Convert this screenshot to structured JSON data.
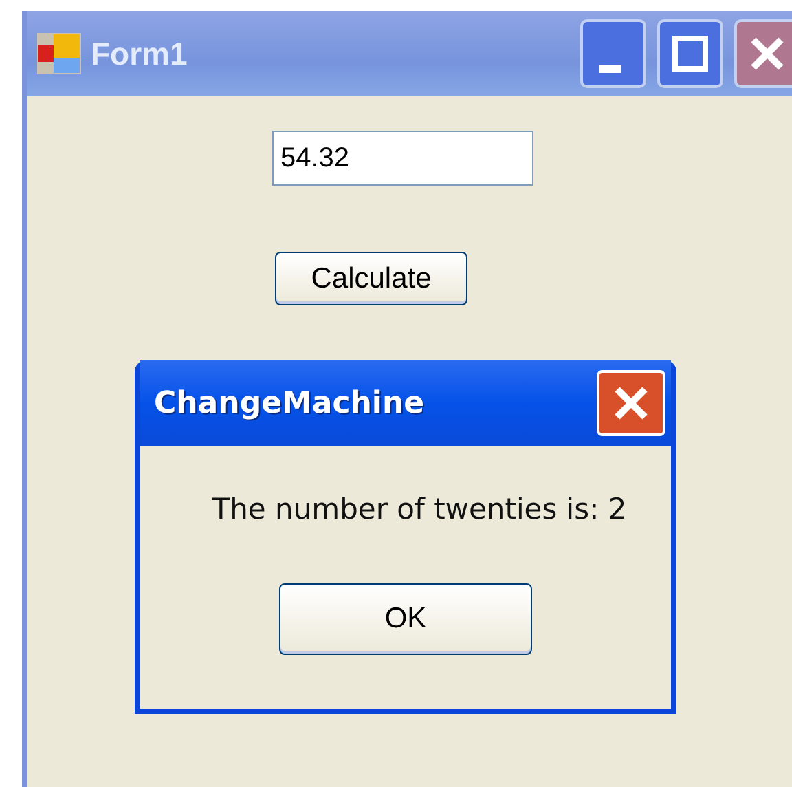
{
  "window": {
    "title": "Form1"
  },
  "amount_field": {
    "value": "54.32"
  },
  "calculate_button": {
    "label": "Calculate"
  },
  "dialog": {
    "title": "ChangeMachine",
    "message": "The number of twenties is: 2",
    "button": "OK"
  }
}
